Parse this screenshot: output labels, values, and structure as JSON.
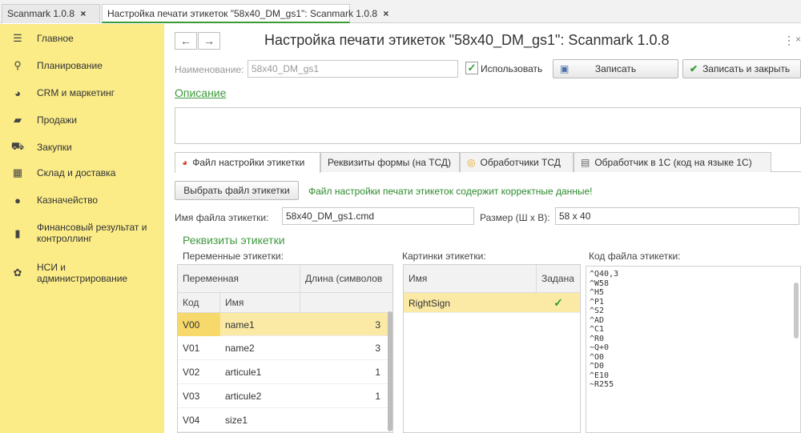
{
  "window_tabs": [
    {
      "label": "Scanmark 1.0.8",
      "close": "×"
    },
    {
      "label": "Настройка печати этикеток \"58x40_DM_gs1\": Scanmark 1.0.8",
      "close": "×"
    }
  ],
  "sidebar": {
    "items": [
      {
        "label": "Главное",
        "icon": "menu-icon"
      },
      {
        "label": "Планирование",
        "icon": "planning-icon"
      },
      {
        "label": "CRM и маркетинг",
        "icon": "pie-icon"
      },
      {
        "label": "Продажи",
        "icon": "bag-icon"
      },
      {
        "label": "Закупки",
        "icon": "cart-icon"
      },
      {
        "label": "Склад и доставка",
        "icon": "warehouse-icon"
      },
      {
        "label": "Казначейство",
        "icon": "coin-icon"
      },
      {
        "label": "Финансовый результат и контроллинг",
        "icon": "chart-icon"
      },
      {
        "label": "НСИ и администрирование",
        "icon": "gear-icon"
      }
    ]
  },
  "header": {
    "back": "←",
    "forward": "→",
    "title": "Настройка печати этикеток \"58x40_DM_gs1\": Scanmark 1.0.8",
    "more": "⋮",
    "close": "×"
  },
  "form": {
    "name_label": "Наименование:",
    "name_value": "58x40_DM_gs1",
    "use_label": "Использовать",
    "use_checked": "✓",
    "save_label": "Записать",
    "save_close_label": "Записать и закрыть",
    "description_link": "Описание"
  },
  "tabs": [
    {
      "label": "Файл настройки этикетки"
    },
    {
      "label": "Реквизиты формы (на ТСД)"
    },
    {
      "label": "Обработчики ТСД"
    },
    {
      "label": "Обработчик в 1С  (код на языке 1С)"
    }
  ],
  "file_tab": {
    "choose_button": "Выбрать файл этикетки",
    "status_text": "Файл настройки печати этикеток содержит корректные данные!",
    "filename_label": "Имя файла этикетки:",
    "filename_value": "58x40_DM_gs1.cmd",
    "size_label": "Размер (Ш x В):",
    "size_value": "58 x 40",
    "section_title": "Реквизиты этикетки",
    "vars_label": "Переменные этикетки:",
    "images_label": "Картинки этикетки:",
    "code_label": "Код файла этикетки:"
  },
  "vars_table": {
    "headers": {
      "var": "Переменная",
      "len": "Длина (символов",
      "code": "Код",
      "name": "Имя"
    },
    "rows": [
      {
        "code": "V00",
        "name": "name1",
        "len": "3"
      },
      {
        "code": "V01",
        "name": "name2",
        "len": "3"
      },
      {
        "code": "V02",
        "name": "articule1",
        "len": "1"
      },
      {
        "code": "V03",
        "name": "articule2",
        "len": "1"
      },
      {
        "code": "V04",
        "name": "size1",
        "len": ""
      }
    ]
  },
  "images_table": {
    "headers": {
      "name": "Имя",
      "set": "Задана"
    },
    "rows": [
      {
        "name": "RightSign",
        "set": "✓"
      }
    ]
  },
  "code_text": "^Q40,3\n^W58\n^H5\n^P1\n^S2\n^AD\n^C1\n^R0\n~Q+0\n^O0\n^D0\n^E10\n~R255"
}
